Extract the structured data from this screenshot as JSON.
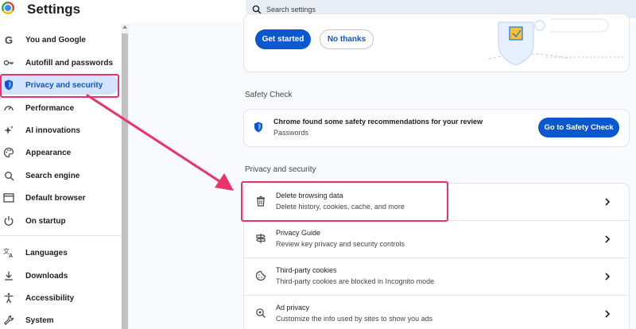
{
  "header": {
    "title": "Settings",
    "search_placeholder": "Search settings"
  },
  "sidebar": {
    "items": [
      {
        "label": "You and Google",
        "icon": "google-g-icon"
      },
      {
        "label": "Autofill and passwords",
        "icon": "key-icon"
      },
      {
        "label": "Privacy and security",
        "icon": "shield-icon",
        "active": true
      },
      {
        "label": "Performance",
        "icon": "speedometer-icon"
      },
      {
        "label": "AI innovations",
        "icon": "sparkle-icon"
      },
      {
        "label": "Appearance",
        "icon": "palette-icon"
      },
      {
        "label": "Search engine",
        "icon": "search-icon"
      },
      {
        "label": "Default browser",
        "icon": "browser-window-icon"
      },
      {
        "label": "On startup",
        "icon": "power-icon"
      },
      {
        "label": "Languages",
        "icon": "translate-icon"
      },
      {
        "label": "Downloads",
        "icon": "download-icon"
      },
      {
        "label": "Accessibility",
        "icon": "accessibility-icon"
      },
      {
        "label": "System",
        "icon": "wrench-icon"
      }
    ]
  },
  "promo": {
    "primary_label": "Get started",
    "secondary_label": "No thanks"
  },
  "safety_check": {
    "section_title": "Safety Check",
    "message": "Chrome found some safety recommendations for your review",
    "sub": "Passwords",
    "button_label": "Go to Safety Check"
  },
  "privacy": {
    "section_title": "Privacy and security",
    "rows": [
      {
        "title": "Delete browsing data",
        "subtitle": "Delete history, cookies, cache, and more",
        "icon": "trash-icon"
      },
      {
        "title": "Privacy Guide",
        "subtitle": "Review key privacy and security controls",
        "icon": "signpost-icon"
      },
      {
        "title": "Third-party cookies",
        "subtitle": "Third-party cookies are blocked in Incognito mode",
        "icon": "cookie-icon"
      },
      {
        "title": "Ad privacy",
        "subtitle": "Customize the info used by sites to show you ads",
        "icon": "ad-privacy-icon"
      }
    ]
  },
  "colors": {
    "accent": "#0b57d0",
    "annotation": "#e8336d",
    "active_bg": "#d3e3fd",
    "page_bg": "#f8fafd"
  }
}
